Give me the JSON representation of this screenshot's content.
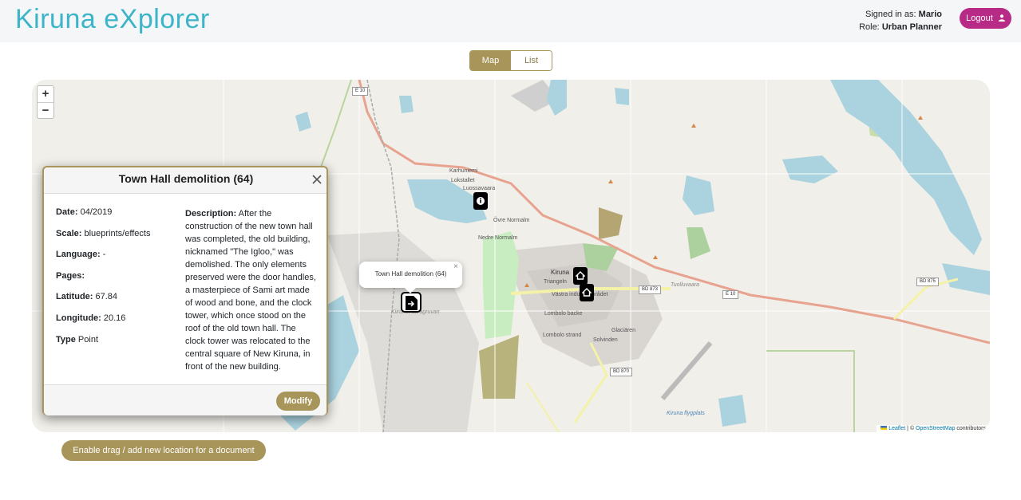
{
  "app": {
    "title": "Kiruna eXplorer",
    "signed_in_label": "Signed in as:",
    "user_name": "Mario",
    "role_label": "Role:",
    "role": "Urban Planner",
    "logout_label": "Logout"
  },
  "view_toggle": {
    "map_label": "Map",
    "list_label": "List",
    "active": "Map"
  },
  "map": {
    "zoom_in": "+",
    "zoom_out": "−",
    "attribution": {
      "leaflet": "Leaflet",
      "sep": " | © ",
      "osm": "OpenStreetMap",
      "suffix": " contributors"
    },
    "labels": {
      "karhuniemi": "Karhuniemi",
      "lokstallet": "Lokstallet",
      "luossavaara": "Luossavaara",
      "ovre_normalm": "Övre Normalm",
      "nedre_normalm": "Nedre Normalm",
      "kiruna": "Kiruna",
      "triangeln": "Triangeln",
      "vastra": "Västra industriområdet",
      "lombolo_backe": "Lombolo backe",
      "lombolo_strand": "Lombolo strand",
      "solvinden": "Solvinden",
      "glaciaren": "Glaciären",
      "tuolluvaara": "Tuolluvaara",
      "kiirunavaaragruvan": "Kiirunavaaragruvan",
      "kiruna_flygplats": "Kiruna flygplats",
      "e10": "E 10",
      "bd873": "BD 873",
      "bd870": "BD 870",
      "bd875": "BD 875"
    },
    "tooltip": "Town Hall demolition (64)",
    "tooltip_close": "×"
  },
  "popup": {
    "title": "Town Hall demolition (64)",
    "date_label": "Date:",
    "date": "04/2019",
    "scale_label": "Scale:",
    "scale": "blueprints/effects",
    "language_label": "Language:",
    "language": "-",
    "pages_label": "Pages:",
    "pages": "",
    "latitude_label": "Latitude:",
    "latitude": "67.84",
    "longitude_label": "Longitude:",
    "longitude": "20.16",
    "type_label": "Type",
    "type": "Point",
    "description_label": "Description:",
    "description": "After the construction of the new town hall was completed, the old building, nicknamed \"The Igloo,\" was demolished. The only elements preserved were the door handles, a masterpiece of Sami art made of wood and bone, and the clock tower, which once stood on the roof of the old town hall. The clock tower was relocated to the central square of New Kiruna, in front of the new building.",
    "modify_label": "Modify"
  },
  "drag_button_label": "Enable drag / add new location for a document",
  "colors": {
    "brand": "#3cb4c9",
    "accent": "#a89559",
    "logout": "#b72a86",
    "water": "#aad3df"
  }
}
